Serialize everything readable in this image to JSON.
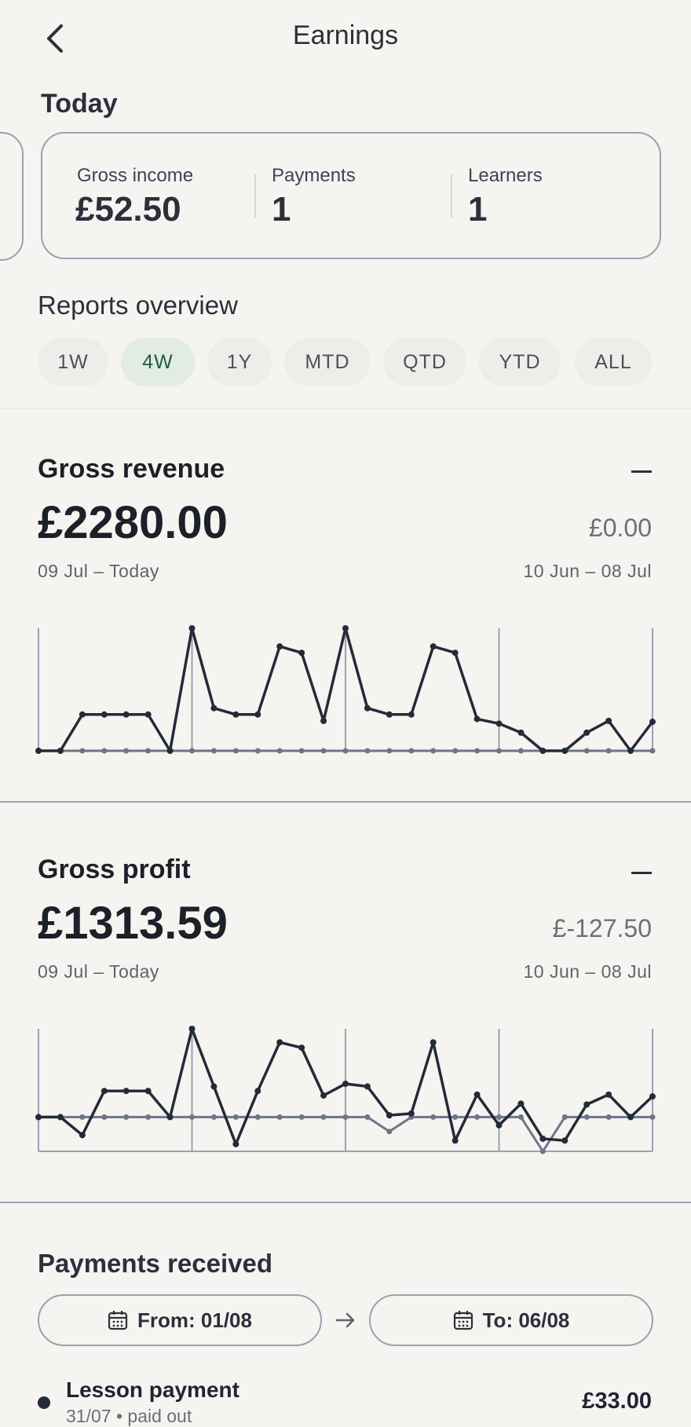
{
  "header": {
    "title": "Earnings",
    "back_icon": "chevron-left-icon"
  },
  "today": {
    "heading": "Today",
    "stats": [
      {
        "label": "Gross income",
        "value": "£52.50"
      },
      {
        "label": "Payments",
        "value": "1"
      },
      {
        "label": "Learners",
        "value": "1"
      }
    ]
  },
  "reports": {
    "heading": "Reports overview",
    "ranges": [
      "1W",
      "4W",
      "1Y",
      "MTD",
      "QTD",
      "YTD",
      "ALL"
    ],
    "selected": "4W"
  },
  "gross_revenue": {
    "title": "Gross revenue",
    "value": "£2280.00",
    "previous_value": "£0.00",
    "current_range": "09 Jul – Today",
    "previous_range": "10 Jun – 08 Jul"
  },
  "gross_profit": {
    "title": "Gross profit",
    "value": "£1313.59",
    "previous_value": "£-127.50",
    "current_range": "09 Jul – Today",
    "previous_range": "10 Jun – 08 Jul"
  },
  "payments": {
    "heading": "Payments received",
    "from_label": "From: 01/08",
    "to_label": "To: 06/08",
    "calendar_icon": "calendar-icon",
    "arrow_icon": "arrow-right-icon",
    "items": [
      {
        "title": "Lesson payment",
        "subtitle": "31/07 • paid out",
        "amount": "£33.00"
      }
    ]
  },
  "colors": {
    "current_series": "#232a38",
    "previous_series": "#6e7587",
    "selected_chip_bg": "#e2ece5",
    "selected_chip_text": "#1f5d3c"
  },
  "chart_data": [
    {
      "type": "line",
      "title": "",
      "series": [
        {
          "values": [
            0,
            0,
            40,
            40,
            40,
            40,
            0,
            135,
            47,
            40,
            40,
            115,
            108,
            33,
            135,
            47,
            40,
            40,
            115,
            108,
            35,
            30,
            20,
            0,
            0,
            20,
            33,
            0,
            32
          ]
        },
        {
          "values": [
            0,
            0,
            0,
            0,
            0,
            0,
            0,
            0,
            0,
            0,
            0,
            0,
            0,
            0,
            0,
            0,
            0,
            0,
            0,
            0,
            0,
            0,
            0,
            0,
            0,
            0,
            0,
            0,
            0
          ]
        }
      ],
      "ylim": [
        0,
        135
      ]
    },
    {
      "type": "line",
      "title": "",
      "series": [
        {
          "values": [
            0,
            0,
            -20,
            29,
            29,
            29,
            0,
            98,
            34,
            -30,
            29,
            83,
            77,
            24,
            37,
            34,
            2,
            4,
            83,
            -26,
            25,
            -9,
            15,
            -24,
            -26,
            14,
            25,
            0,
            23
          ]
        },
        {
          "values": [
            0,
            0,
            0,
            0,
            0,
            0,
            0,
            0,
            0,
            0,
            0,
            0,
            0,
            0,
            0,
            0,
            -16,
            0,
            0,
            0,
            0,
            0,
            0,
            -38,
            0,
            0,
            0,
            0,
            0
          ]
        }
      ],
      "ylim": [
        -38,
        98
      ]
    }
  ]
}
